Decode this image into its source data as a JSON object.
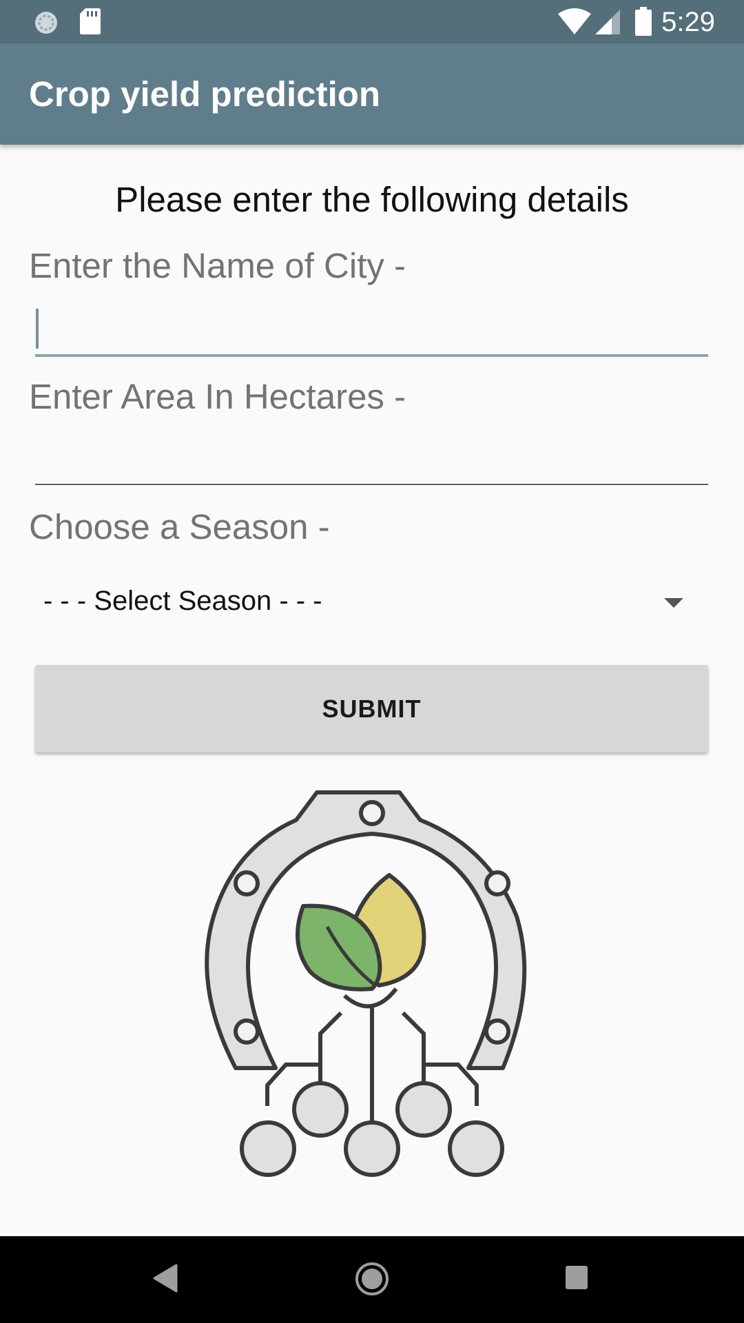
{
  "status_bar": {
    "time": "5:29",
    "icons": [
      "sync-icon",
      "sd-card-icon",
      "wifi-icon",
      "cell-signal-icon",
      "battery-icon"
    ],
    "background": "#546e7a"
  },
  "app_bar": {
    "title": "Crop yield prediction",
    "background": "#607d8b"
  },
  "form": {
    "heading": "Please enter the following details",
    "city_label": "Enter the Name of City -",
    "city_value": "",
    "area_label": "Enter Area In Hectares -",
    "area_value": "",
    "season_label": "Choose a Season -",
    "season_selected": "- - - Select Season - - -",
    "submit_label": "SUBMIT"
  },
  "logo": {
    "icon": "gear-leaf-circuit-logo",
    "colors": {
      "leaf_green": "#7cb46a",
      "leaf_yellow": "#e2d278",
      "gear": "#dcdcdc",
      "outline": "#3a3a3a"
    }
  },
  "nav_bar": {
    "buttons": [
      "back-icon",
      "home-icon",
      "recents-icon"
    ]
  }
}
